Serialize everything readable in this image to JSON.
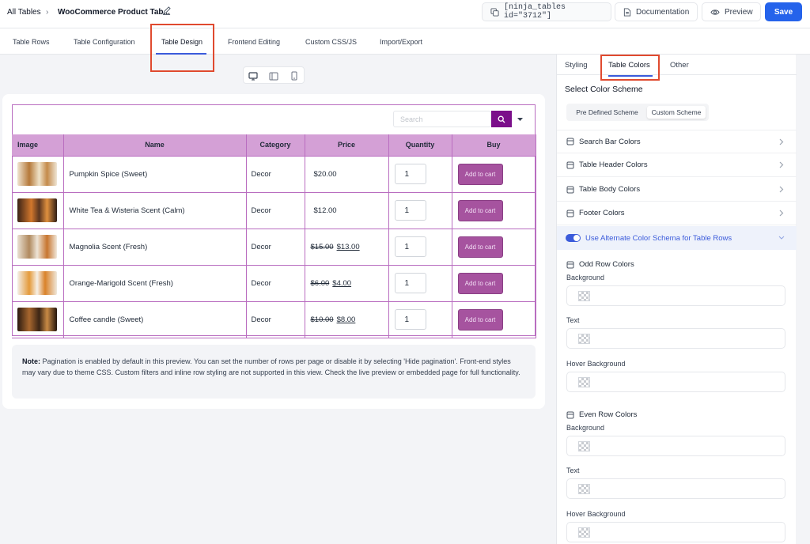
{
  "breadcrumb": {
    "root": "All Tables",
    "separator": "›",
    "title": "WooCommerce Product Tab..."
  },
  "toolbar": {
    "shortcode": "[ninja_tables id=\"3712\"]",
    "documentation": "Documentation",
    "preview": "Preview",
    "save": "Save"
  },
  "main_tabs": [
    "Table Rows",
    "Table Configuration",
    "Table Design",
    "Frontend Editing",
    "Custom CSS/JS",
    "Import/Export"
  ],
  "search": {
    "placeholder": "Search"
  },
  "table": {
    "headers": [
      "Image",
      "Name",
      "Category",
      "Price",
      "Quantity",
      "Buy"
    ],
    "rows": [
      {
        "name": "Pumpkin Spice (Sweet)",
        "category": "Decor",
        "price_old": "",
        "price": "$20.00",
        "qty": "1",
        "buy": "Add to cart"
      },
      {
        "name": "White Tea & Wisteria Scent (Calm)",
        "category": "Decor",
        "price_old": "",
        "price": "$12.00",
        "qty": "1",
        "buy": "Add to cart"
      },
      {
        "name": "Magnolia Scent (Fresh)",
        "category": "Decor",
        "price_old": "$15.00",
        "price": "$13.00",
        "qty": "1",
        "buy": "Add to cart"
      },
      {
        "name": "Orange-Marigold Scent (Fresh)",
        "category": "Decor",
        "price_old": "$6.00",
        "price": "$4.00",
        "qty": "1",
        "buy": "Add to cart"
      },
      {
        "name": "Coffee candle (Sweet)",
        "category": "Decor",
        "price_old": "$10.00",
        "price": "$8.00",
        "qty": "1",
        "buy": "Add to cart"
      }
    ]
  },
  "note": {
    "label": "Note:",
    "text": " Pagination is enabled by default in this preview. You can set the number of rows per page or disable it by selecting 'Hide pagination'. Front-end styles may vary due to theme CSS. Custom filters and inline row styling are not supported in this view. Check the live preview or embedded page for full functionality."
  },
  "panel": {
    "tabs": [
      "Styling",
      "Table Colors",
      "Other"
    ],
    "scheme_title": "Select Color Scheme",
    "scheme_options": [
      "Pre Defined Scheme",
      "Custom Scheme"
    ],
    "sections": [
      "Search Bar Colors",
      "Table Header Colors",
      "Table Body Colors",
      "Footer Colors"
    ],
    "alternate_label": "Use Alternate Color Schema for Table Rows",
    "odd": {
      "title": "Odd Row Colors",
      "fields": [
        "Background",
        "Text",
        "Hover Background"
      ]
    },
    "even": {
      "title": "Even Row Colors",
      "fields": [
        "Background",
        "Text",
        "Hover Background"
      ]
    }
  },
  "colors": {
    "accent": "#2563eb",
    "header_bg": "#d4a0d6",
    "border": "#b96dc0",
    "cart_button": "#a6539f",
    "search_button": "#7b0f8a",
    "highlight": "#e04a2f"
  }
}
